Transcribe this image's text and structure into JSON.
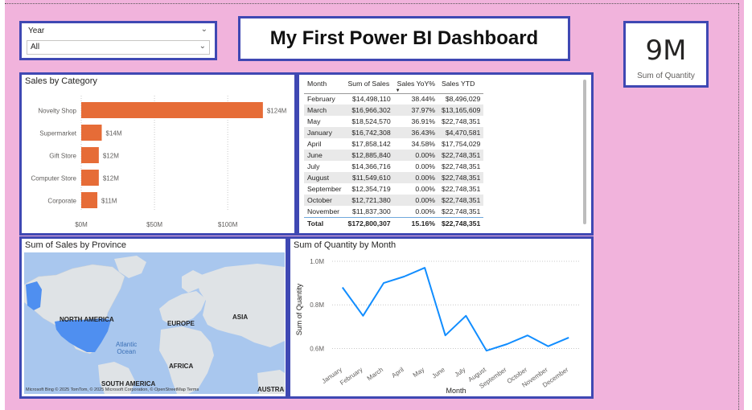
{
  "slicer": {
    "title": "Year",
    "value": "All"
  },
  "header": {
    "title": "My First Power BI Dashboard"
  },
  "kpi": {
    "value": "9M",
    "label": "Sum of Quantity"
  },
  "sales_by_category": {
    "title": "Sales by Category",
    "categories": [
      "Novelty Shop",
      "Supermarket",
      "Gift Store",
      "Computer Store",
      "Corporate"
    ],
    "labels": [
      "$124M",
      "$14M",
      "$12M",
      "$12M",
      "$11M"
    ],
    "x_ticks": [
      "$0M",
      "$50M",
      "$100M"
    ]
  },
  "sales_table": {
    "columns": [
      "Month",
      "Sum of Sales",
      "Sales YoY%",
      "Sales YTD"
    ],
    "rows": [
      [
        "February",
        "$14,498,110",
        "38.44%",
        "$8,496,029"
      ],
      [
        "March",
        "$16,966,302",
        "37.97%",
        "$13,165,609"
      ],
      [
        "May",
        "$18,524,570",
        "36.91%",
        "$22,748,351"
      ],
      [
        "January",
        "$16,742,308",
        "36.43%",
        "$4,470,581"
      ],
      [
        "April",
        "$17,858,142",
        "34.58%",
        "$17,754,029"
      ],
      [
        "June",
        "$12,885,840",
        "0.00%",
        "$22,748,351"
      ],
      [
        "July",
        "$14,366,716",
        "0.00%",
        "$22,748,351"
      ],
      [
        "August",
        "$11,549,610",
        "0.00%",
        "$22,748,351"
      ],
      [
        "September",
        "$12,354,719",
        "0.00%",
        "$22,748,351"
      ],
      [
        "October",
        "$12,721,380",
        "0.00%",
        "$22,748,351"
      ],
      [
        "November",
        "$11,837,300",
        "0.00%",
        "$22,748,351"
      ]
    ],
    "total": [
      "Total",
      "$172,800,307",
      "15.16%",
      "$22,748,351"
    ]
  },
  "map": {
    "title": "Sum of Sales by Province",
    "labels": {
      "north_america": "NORTH AMERICA",
      "europe": "EUROPE",
      "asia": "ASIA",
      "africa": "AFRICA",
      "south_america": "SOUTH AMERICA",
      "ocean_1": "Atlantic",
      "ocean_2": "Ocean",
      "australia": "AUSTRAL"
    },
    "attribution": "Microsoft Bing   © 2025 TomTom, © 2025 Microsoft Corporation, © OpenStreetMap  Terms"
  },
  "line_chart": {
    "title": "Sum of Quantity by Month"
  },
  "chart_data": [
    {
      "type": "bar",
      "title": "Sales by Category",
      "categories": [
        "Novelty Shop",
        "Supermarket",
        "Gift Store",
        "Computer Store",
        "Corporate"
      ],
      "values": [
        124,
        14,
        12,
        12,
        11
      ],
      "value_unit": "$M",
      "xlim": [
        0,
        140
      ],
      "x_ticks": [
        0,
        50,
        100
      ],
      "color": "#e66c37",
      "grid": true
    },
    {
      "type": "line",
      "title": "Sum of Quantity by Month",
      "xlabel": "Month",
      "ylabel": "Sum of Quantity",
      "x": [
        "January",
        "February",
        "March",
        "April",
        "May",
        "June",
        "July",
        "August",
        "September",
        "October",
        "November",
        "December"
      ],
      "values": [
        0.88,
        0.75,
        0.9,
        0.93,
        0.97,
        0.66,
        0.75,
        0.59,
        0.62,
        0.66,
        0.61,
        0.65
      ],
      "value_unit": "M",
      "y_ticks": [
        "0.6M",
        "0.8M",
        "1.0M"
      ],
      "ylim": [
        0.55,
        1.0
      ],
      "color": "#118dff",
      "grid": true
    }
  ]
}
